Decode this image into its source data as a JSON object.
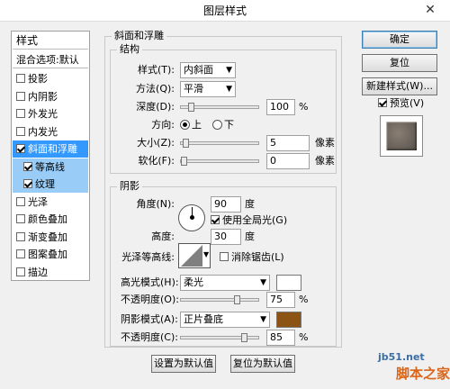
{
  "window": {
    "title": "图层样式",
    "close": "✕"
  },
  "styles_panel": {
    "header": "样式",
    "blend": "混合选项:默认",
    "items": [
      {
        "label": "投影",
        "checked": false
      },
      {
        "label": "内阴影",
        "checked": false
      },
      {
        "label": "外发光",
        "checked": false
      },
      {
        "label": "内发光",
        "checked": false
      },
      {
        "label": "斜面和浮雕",
        "checked": true
      },
      {
        "label": "等高线",
        "checked": true
      },
      {
        "label": "纹理",
        "checked": true
      },
      {
        "label": "光泽",
        "checked": false
      },
      {
        "label": "颜色叠加",
        "checked": false
      },
      {
        "label": "渐变叠加",
        "checked": false
      },
      {
        "label": "图案叠加",
        "checked": false
      },
      {
        "label": "描边",
        "checked": false
      }
    ]
  },
  "bevel": {
    "title": "斜面和浮雕",
    "structure": {
      "title": "结构",
      "style_label": "样式(T):",
      "style_value": "内斜面",
      "technique_label": "方法(Q):",
      "technique_value": "平滑",
      "depth_label": "深度(D):",
      "depth_value": "100",
      "depth_unit": "%",
      "depth_fraction": 0.1,
      "direction_label": "方向:",
      "dir_up": "上",
      "dir_down": "下",
      "direction": "up",
      "size_label": "大小(Z):",
      "size_value": "5",
      "size_unit": "像素",
      "size_fraction": 0.02,
      "soften_label": "软化(F):",
      "soften_value": "0",
      "soften_unit": "像素",
      "soften_fraction": 0.0
    },
    "shading": {
      "title": "阴影",
      "angle_label": "角度(N):",
      "angle_value": "90",
      "angle_unit": "度",
      "global_light": "使用全局光(G)",
      "global_light_checked": true,
      "altitude_label": "高度:",
      "altitude_value": "30",
      "altitude_unit": "度",
      "gloss_label": "光泽等高线:",
      "antialias": "消除锯齿(L)",
      "antialias_checked": false,
      "hl_mode_label": "高光模式(H):",
      "hl_mode_value": "柔光",
      "hl_color": "#ffffff",
      "hl_opacity_label": "不透明度(O):",
      "hl_opacity_value": "75",
      "hl_opacity_unit": "%",
      "hl_opacity_fraction": 0.75,
      "sh_mode_label": "阴影模式(A):",
      "sh_mode_value": "正片叠底",
      "sh_color": "#8b5415",
      "sh_opacity_label": "不透明度(C):",
      "sh_opacity_value": "85",
      "sh_opacity_unit": "%",
      "sh_opacity_fraction": 0.85
    }
  },
  "footer": {
    "set_default": "设置为默认值",
    "reset_default": "复位为默认值"
  },
  "buttons": {
    "ok": "确定",
    "reset": "复位",
    "new_style": "新建样式(W)...",
    "preview": "预览(V)",
    "preview_checked": true
  },
  "watermark": {
    "site": "jb51.net",
    "brand": "脚本之家"
  }
}
